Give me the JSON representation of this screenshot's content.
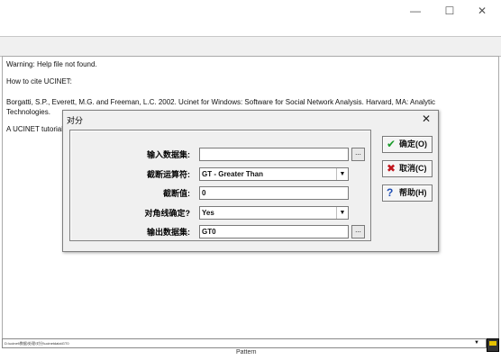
{
  "window": {
    "minimize_glyph": "—",
    "maximize_glyph": "☐",
    "close_glyph": "✕"
  },
  "log": {
    "line1": "Warning: Help file not found.",
    "line2": "How to cite UCINET:",
    "line3": "Borgatti, S.P., Everett, M.G. and Freeman, L.C. 2002. Ucinet for Windows: Software for Social Network Analysis. Harvard, MA: Analytic\nTechnologies.",
    "line4": "A UCINET tutorial"
  },
  "statusbar": {
    "text": "D:\\ucinet\\数据\\处理\\对分\\ucinetdata\\GT0"
  },
  "bottom_partial": "Pattern",
  "dialog": {
    "title": "对分",
    "close_glyph": "✕",
    "fields": {
      "input_label": "输入数据集:",
      "input_value": "",
      "operator_label": "截断运算符:",
      "operator_value": "GT - Greater Than",
      "cutoff_label": "截断值:",
      "cutoff_value": "0",
      "diagonal_label": "对角线确定?",
      "diagonal_value": "Yes",
      "output_label": "输出数据集:",
      "output_value": "GT0"
    },
    "browse_glyph": "...",
    "dropdown_glyph": "▼",
    "buttons": {
      "ok_label": "确定(O)",
      "ok_icon": "check-icon",
      "cancel_label": "取消(C)",
      "cancel_icon": "x-icon",
      "help_label": "帮助(H)",
      "help_icon": "question-icon"
    }
  }
}
